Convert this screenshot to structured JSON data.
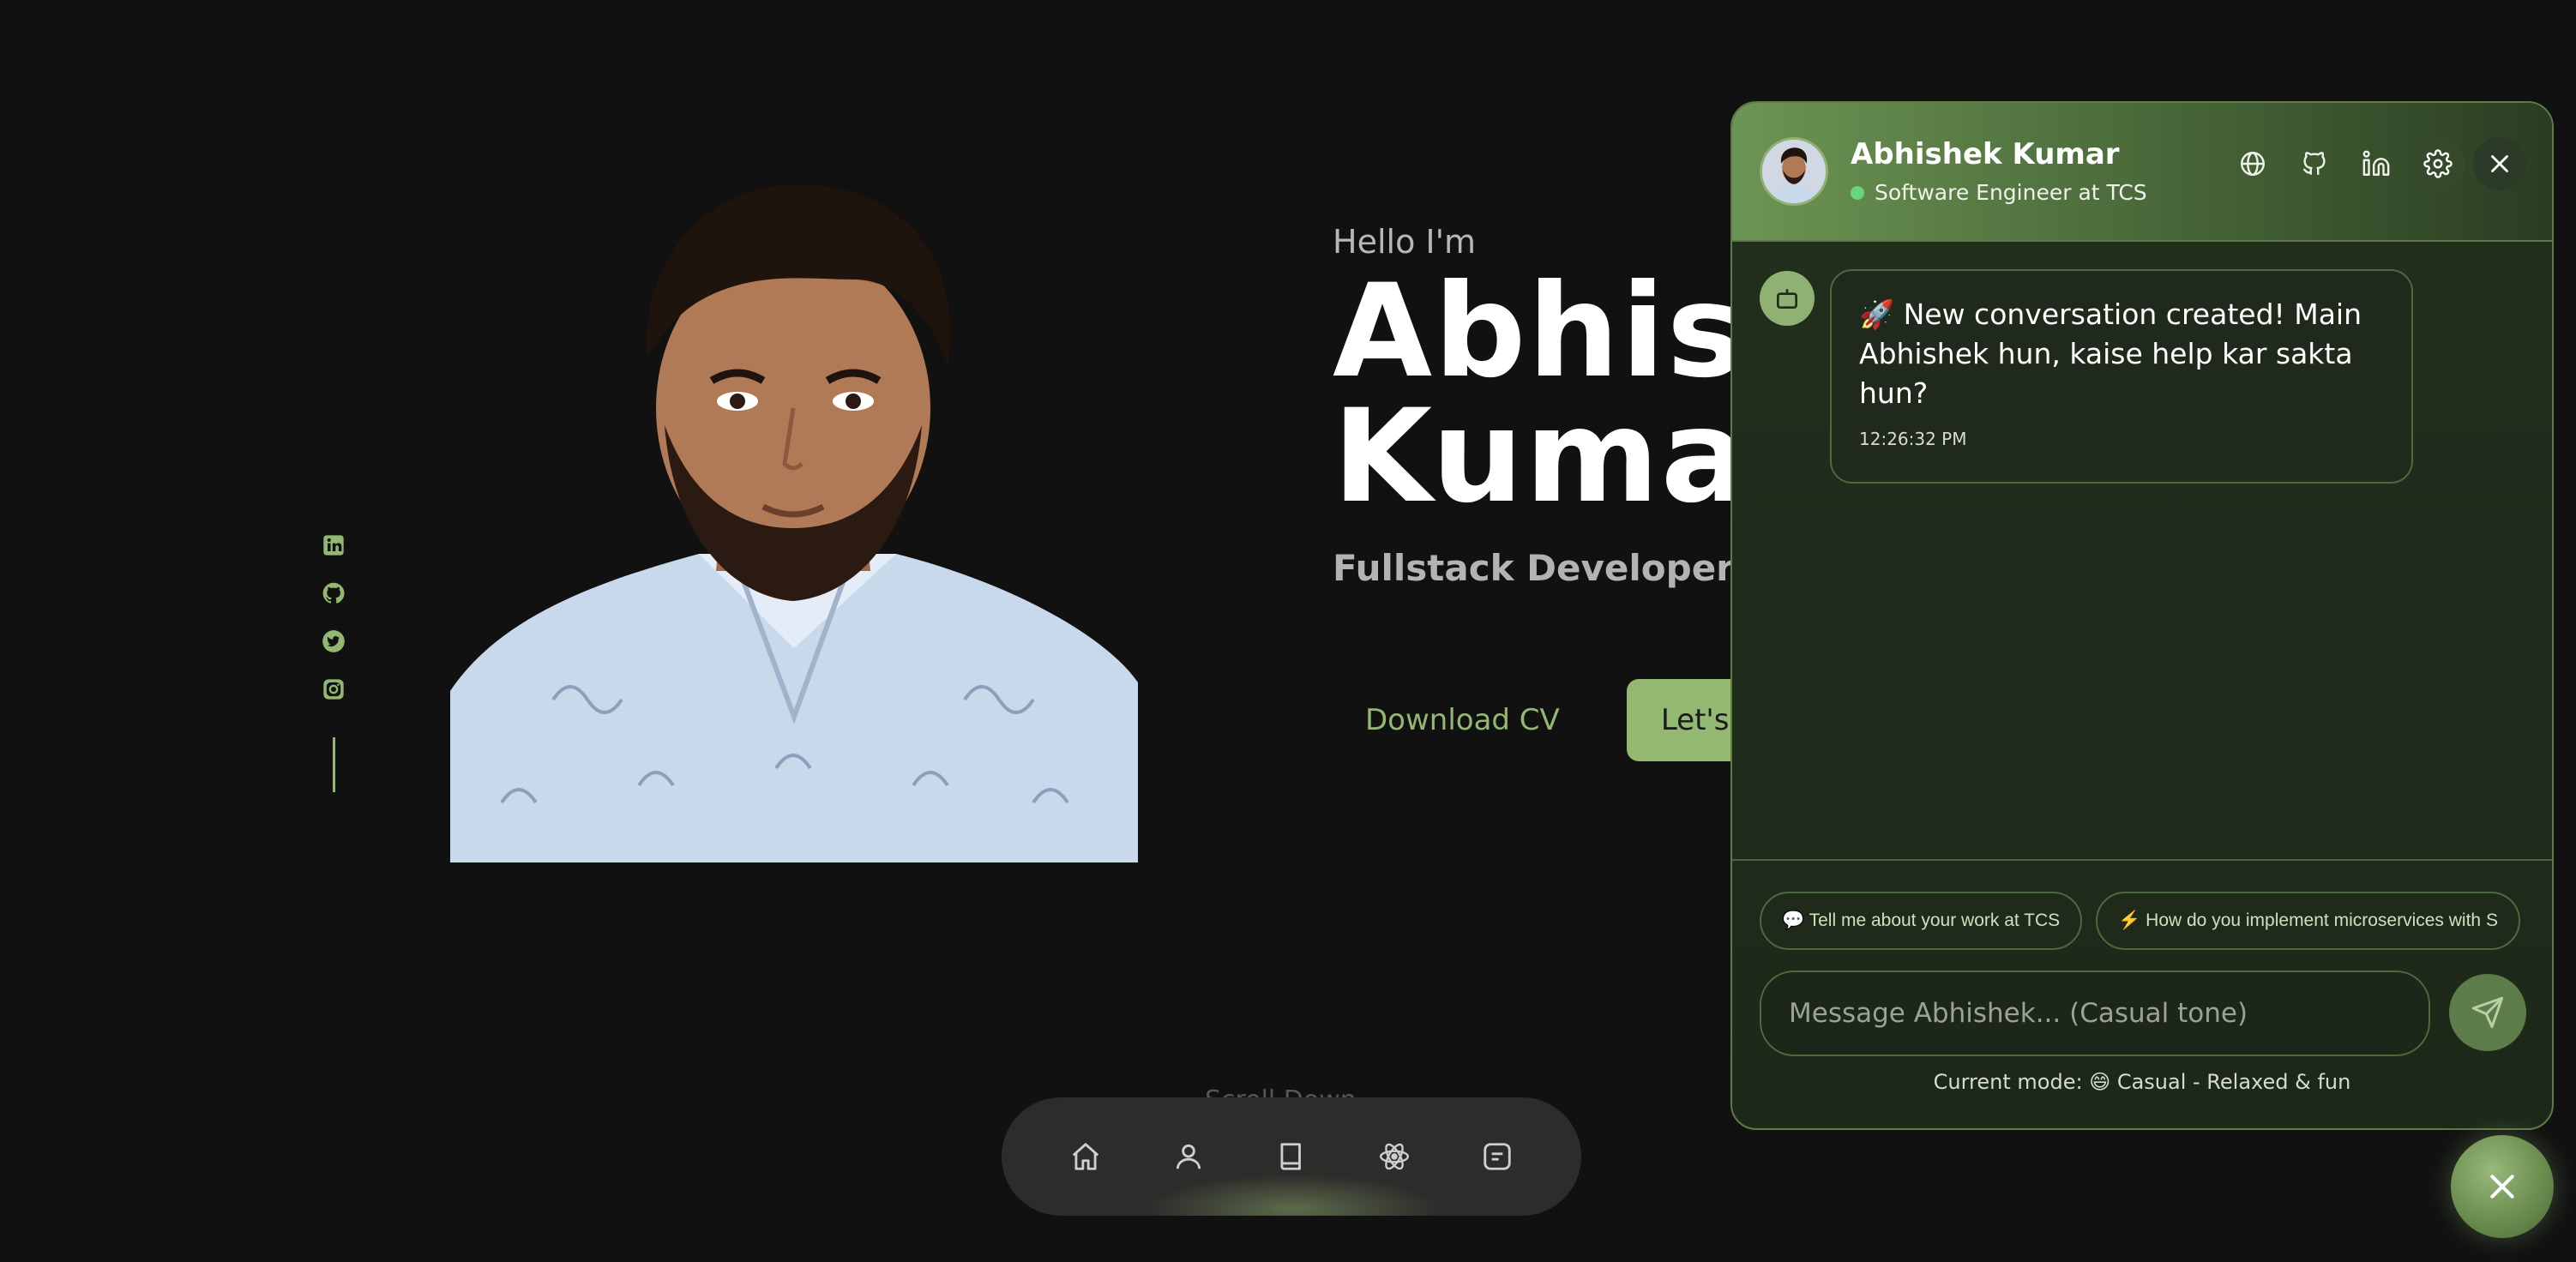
{
  "social": {
    "items": [
      {
        "icon": "linkedin-icon"
      },
      {
        "icon": "github-icon"
      },
      {
        "icon": "twitter-icon"
      },
      {
        "icon": "instagram-icon"
      }
    ]
  },
  "hero": {
    "greeting": "Hello I'm",
    "name_line1": "Abhishek",
    "name_line2": "Kumar",
    "role": "Fullstack Developer",
    "download_label": "Download CV",
    "talk_label": "Let's Talk",
    "scroll_hint": "Scroll Down"
  },
  "nav": {
    "items": [
      {
        "icon": "home-icon"
      },
      {
        "icon": "user-icon"
      },
      {
        "icon": "book-icon"
      },
      {
        "icon": "react-atom-icon"
      },
      {
        "icon": "message-square-icon"
      }
    ]
  },
  "chat": {
    "name": "Abhishek Kumar",
    "status": "Software Engineer at TCS",
    "header_actions": [
      "globe-icon",
      "github-icon",
      "linkedin-icon",
      "settings-icon",
      "close-icon"
    ],
    "messages": [
      {
        "text": "🚀 New conversation created! Main Abhishek hun, kaise help kar sakta hun?",
        "time": "12:26:32 PM"
      }
    ],
    "suggestions": [
      "💬 Tell me about your work at TCS",
      "⚡ How do you implement microservices with S"
    ],
    "input_placeholder": "Message Abhishek... (Casual tone)",
    "mode": "Current mode: 😄 Casual - Relaxed & fun"
  },
  "colors": {
    "accent": "#93b872",
    "background": "#111111",
    "panel": "#1f2b1b"
  }
}
